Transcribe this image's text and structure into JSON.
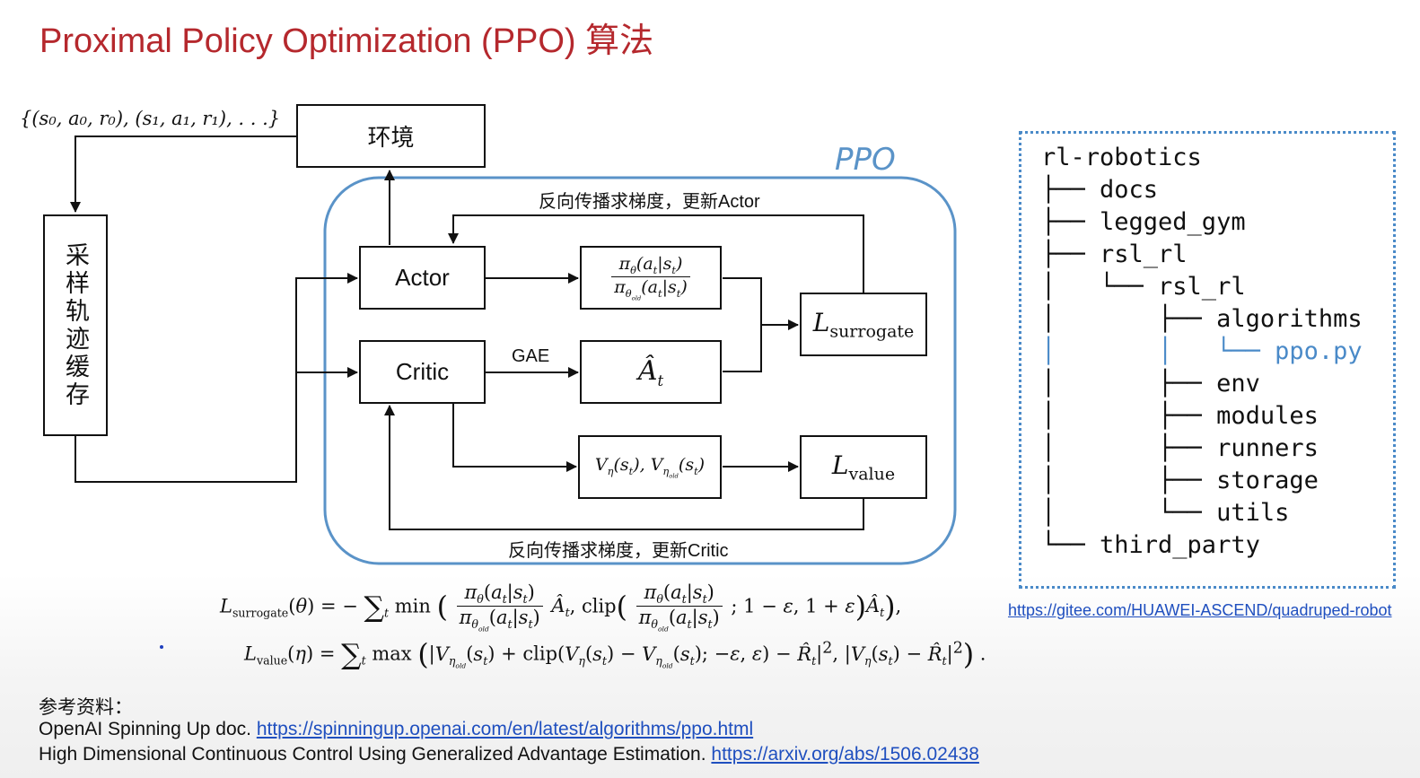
{
  "title": "Proximal Policy Optimization (PPO) 算法",
  "diagram": {
    "trajectory_set": "{(s₀, a₀, r₀), (s₁, a₁, r₁), . . .}",
    "env_label": "环境",
    "buffer_label": "采样轨迹缓存",
    "ppo_label": "PPO",
    "actor_label": "Actor",
    "critic_label": "Critic",
    "gae_label": "GAE",
    "ratio_num": "π",
    "update_actor": "反向传播求梯度，更新Actor",
    "update_critic": "反向传播求梯度，更新Critic",
    "l_surrogate": "L",
    "l_surrogate_sub": "surrogate",
    "l_value": "L",
    "l_value_sub": "value"
  },
  "tree": {
    "lines": [
      "rl-robotics",
      "├── docs",
      "├── legged_gym",
      "├── rsl_rl",
      "│   └── rsl_rl",
      "│       ├── algorithms",
      "│       │   └── ppo.py",
      "│       ├── env",
      "│       ├── modules",
      "│       ├── runners",
      "│       ├── storage",
      "│       └── utils",
      "└── third_party"
    ],
    "link": "https://gitee.com/HUAWEI-ASCEND/quadruped-robot"
  },
  "refs": {
    "heading": "参考资料：",
    "ref1_text": "OpenAI Spinning Up doc. ",
    "ref1_link": "https://spinningup.openai.com/en/latest/algorithms/ppo.html",
    "ref2_text": "High Dimensional Continuous Control Using Generalized Advantage Estimation. ",
    "ref2_link": "https://arxiv.org/abs/1506.02438"
  }
}
